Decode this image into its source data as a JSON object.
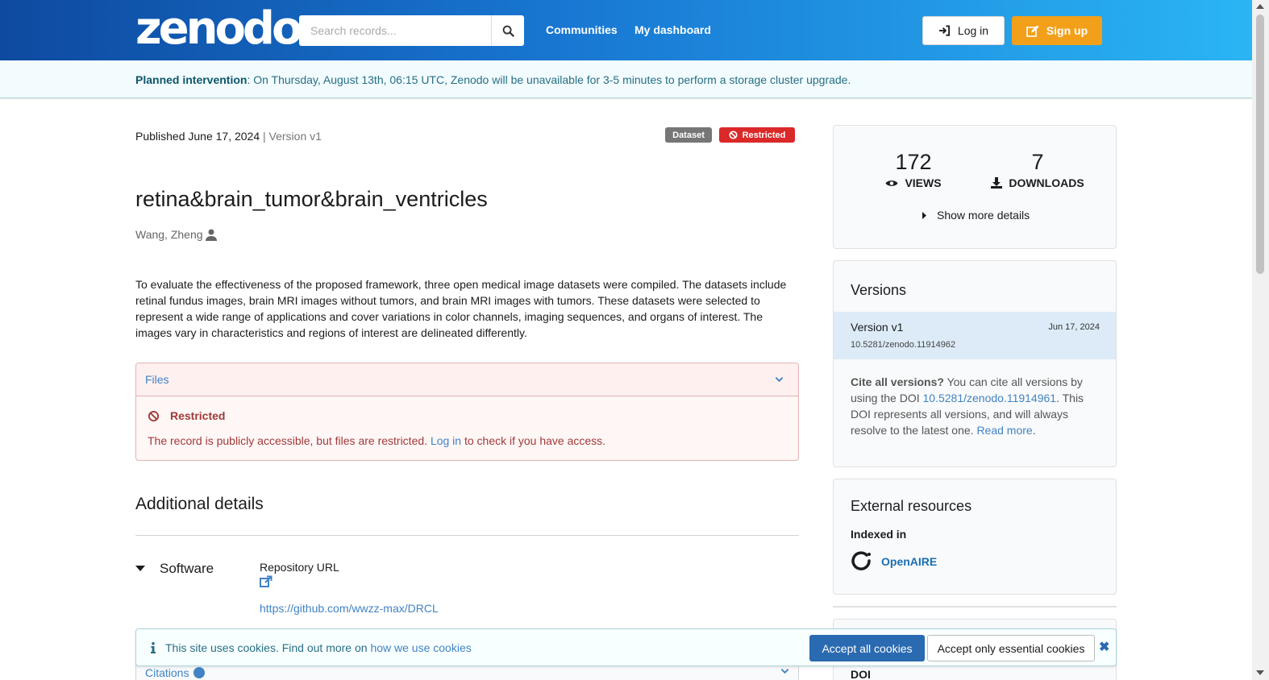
{
  "header": {
    "logo_text": "zenodo",
    "search_placeholder": "Search records...",
    "nav": [
      "Communities",
      "My dashboard"
    ],
    "login_label": "Log in",
    "signup_label": "Sign up"
  },
  "banner": {
    "bold": "Planned intervention",
    "text": ": On Thursday, August 13th, 06:15 UTC, Zenodo will be unavailable for 3-5 minutes to perform a storage cluster upgrade."
  },
  "record": {
    "published": "Published June 17, 2024",
    "version_sep": " | ",
    "version": "Version v1",
    "badge_type": "Dataset",
    "badge_access": "Restricted",
    "title": "retina&brain_tumor&brain_ventricles",
    "author": "Wang, Zheng",
    "description": "To evaluate the effectiveness of the proposed framework, three open medical image datasets were compiled. The datasets include retinal fundus images, brain MRI images without tumors, and brain MRI images with tumors. These datasets were selected to represent a wide range of applications and cover variations in color channels, imaging sequences, and organs of interest. The images vary in characteristics and regions of interest are delineated differently."
  },
  "files": {
    "header": "Files",
    "restricted_title": "Restricted",
    "msg_before": "The record is publicly accessible, but files are restricted. ",
    "msg_link": "Log in",
    "msg_after": " to check if you have access."
  },
  "additional": {
    "title": "Additional details",
    "software_label": "Software",
    "repo_label": "Repository URL",
    "repo_url": "https://github.com/wwzz-max/DRCL",
    "citations_label": "Citations"
  },
  "stats": {
    "views": "172",
    "views_label": "VIEWS",
    "downloads": "7",
    "downloads_label": "DOWNLOADS",
    "show_more": "Show more details"
  },
  "versions": {
    "title": "Versions",
    "current_name": "Version v1",
    "current_date": "Jun 17, 2024",
    "current_doi": "10.5281/zenodo.11914962",
    "cite_bold": "Cite all versions?",
    "cite_before": " You can cite all versions by using the DOI ",
    "cite_doi": "10.5281/zenodo.11914961",
    "cite_after": ". This DOI represents all versions, and will always resolve to the latest one. ",
    "read_more": "Read more"
  },
  "external": {
    "title": "External resources",
    "indexed_in": "Indexed in",
    "openaire": "OpenAIRE"
  },
  "doi_peek": "DOI",
  "cookie": {
    "text": "This site uses cookies. Find out more on ",
    "link": "how we use cookies",
    "accept_all": "Accept all cookies",
    "accept_essential": "Accept only essential cookies"
  },
  "colors": {
    "accent_orange": "#f2a019",
    "restricted_red": "#db2828",
    "link_blue": "#4183c4"
  }
}
